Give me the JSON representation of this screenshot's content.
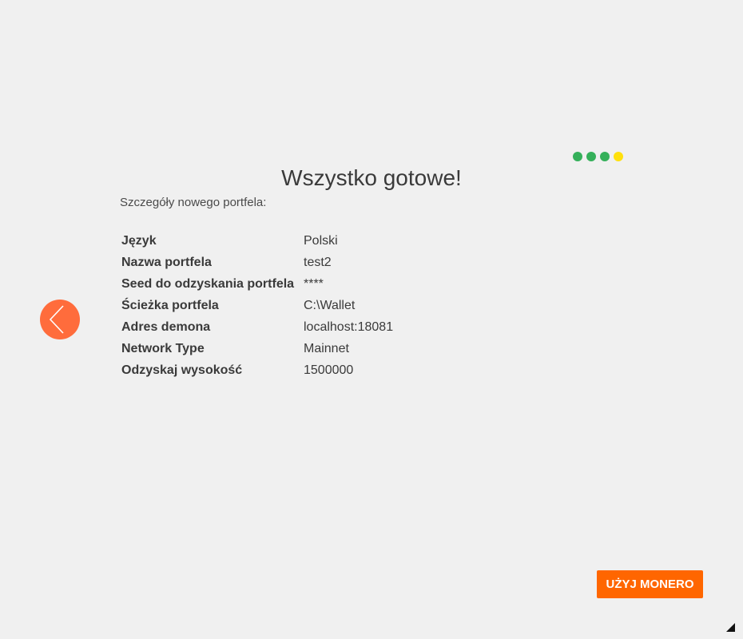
{
  "progress": {
    "total_steps": 4,
    "current_step": 4,
    "colors": {
      "completed": "#35b05a",
      "current": "#ffe00d"
    },
    "steps": [
      {
        "state": "completed",
        "color": "#35b05a"
      },
      {
        "state": "completed",
        "color": "#35b05a"
      },
      {
        "state": "completed",
        "color": "#35b05a"
      },
      {
        "state": "current",
        "color": "#ffe00d"
      }
    ]
  },
  "title": "Wszystko gotowe!",
  "subtitle": "Szczegóły nowego portfela:",
  "details": [
    {
      "label": "Język",
      "value": "Polski"
    },
    {
      "label": "Nazwa portfela",
      "value": "test2"
    },
    {
      "label": "Seed do odzyskania portfela",
      "value": "****"
    },
    {
      "label": "Ścieżka portfela",
      "value": "C:\\Wallet"
    },
    {
      "label": "Adres demona",
      "value": "localhost:18081"
    },
    {
      "label": "Network Type",
      "value": "Mainnet"
    },
    {
      "label": "Odzyskaj wysokość",
      "value": "1500000"
    }
  ],
  "back_button": {
    "icon": "chevron-left-icon",
    "color": "#ff6c3c"
  },
  "use_button": {
    "label": "UŻYJ MONERO",
    "color": "#ff6600"
  },
  "colors": {
    "background": "#f0f0f0",
    "text": "#3a3a3a"
  }
}
